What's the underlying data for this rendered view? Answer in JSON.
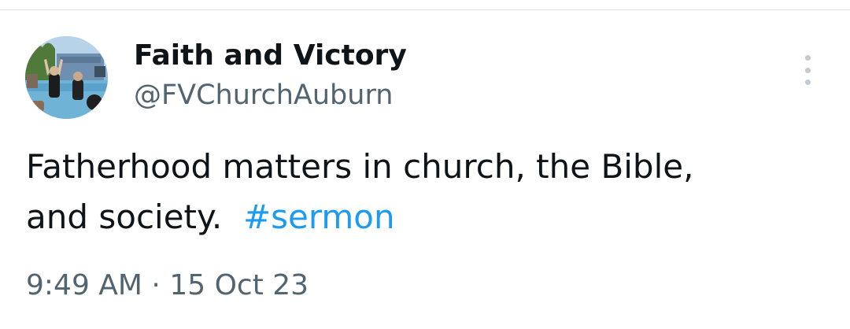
{
  "tweet": {
    "author": {
      "display_name": "Faith and Victory",
      "handle": "@FVChurchAuburn",
      "avatar": "profile-photo"
    },
    "more_icon": "more-vertical-icon",
    "text_line_1": "Fatherhood matters in church, the Bible,",
    "text_line_2_prefix": "and society.",
    "hashtag": "#sermon",
    "time": "9:49 AM",
    "separator": " · ",
    "date": "15 Oct 23"
  },
  "colors": {
    "text": "#0f1419",
    "secondary": "#536471",
    "link": "#1d9bf0",
    "icon_muted": "#c3cbd1"
  }
}
